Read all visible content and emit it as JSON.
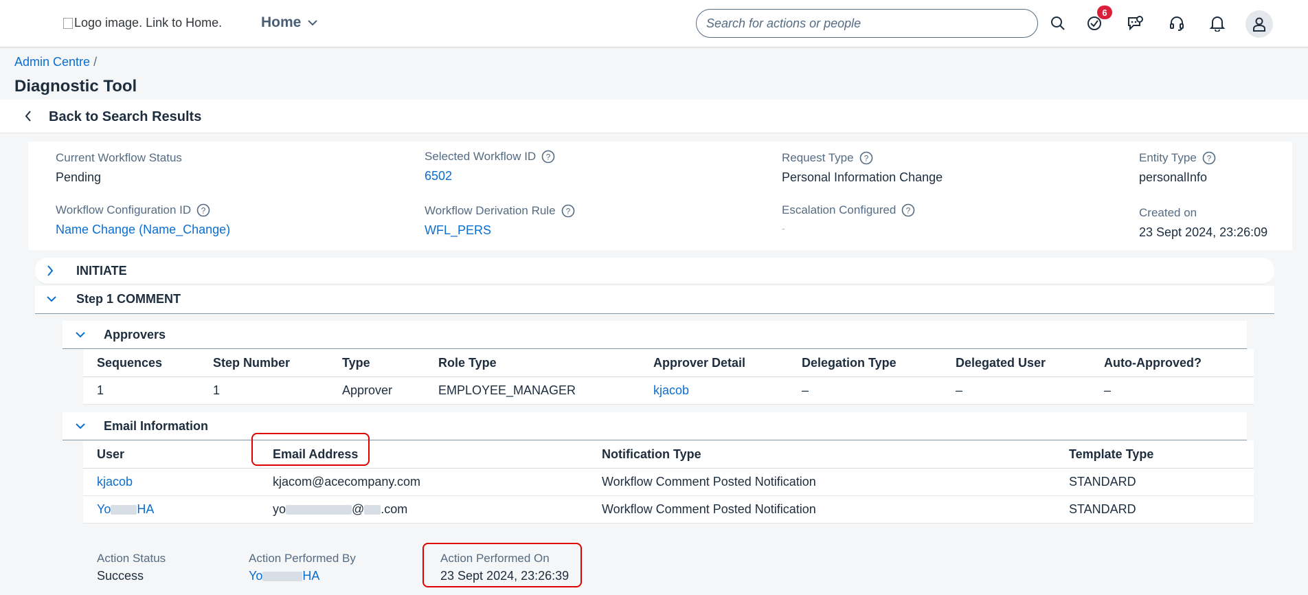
{
  "shell": {
    "logo_alt": "Logo image. Link to Home.",
    "home_label": "Home",
    "search_placeholder": "Search for actions or people",
    "notification_count": "6",
    "accent": "#0a6ed1",
    "badge_color": "#d9203a",
    "icons": [
      "search-icon",
      "task-check-icon",
      "chat-bot-icon",
      "headset-icon",
      "bell-icon",
      "user-avatar-icon"
    ]
  },
  "breadcrumb": {
    "item": "Admin Centre",
    "separator": "/"
  },
  "page_title": "Diagnostic Tool",
  "back_label": "Back to Search Results",
  "header": {
    "current_status_label": "Current Workflow Status",
    "current_status_value": "Pending",
    "workflow_id_label": "Selected Workflow ID",
    "workflow_id_value": "6502",
    "request_type_label": "Request Type",
    "request_type_value": "Personal Information Change",
    "entity_type_label": "Entity Type",
    "entity_type_value": "personalInfo",
    "config_id_label": "Workflow Configuration ID",
    "config_id_value": "Name Change (Name_Change)",
    "derivation_rule_label": "Workflow Derivation Rule",
    "derivation_rule_value": "WFL_PERS",
    "escalation_label": "Escalation Configured",
    "escalation_value": "-",
    "created_on_label": "Created on",
    "created_on_value": "23 Sept 2024, 23:26:09"
  },
  "sections": {
    "initiate": "INITIATE",
    "step1": "Step 1 COMMENT"
  },
  "approvers": {
    "title": "Approvers",
    "columns": [
      "Sequences",
      "Step Number",
      "Type",
      "Role Type",
      "Approver Detail",
      "Delegation Type",
      "Delegated User",
      "Auto-Approved?"
    ],
    "rows": [
      [
        "1",
        "1",
        "Approver",
        "EMPLOYEE_MANAGER",
        "kjacob",
        "–",
        "–",
        "–"
      ]
    ]
  },
  "email": {
    "title": "Email Information",
    "columns": [
      "User",
      "Email Address",
      "Notification Type",
      "Template Type"
    ],
    "rows": [
      [
        "kjacob",
        "kjacom@acecompany.com",
        "Workflow Comment Posted Notification",
        "STANDARD"
      ],
      [
        "Yo",
        "yo",
        "Workflow Comment Posted Notification",
        "STANDARD"
      ]
    ],
    "row2_user_suffix": "HA",
    "row2_email_mid": "@",
    "row2_email_suffix": ".com"
  },
  "action": {
    "status_label": "Action Status",
    "status_value": "Success",
    "performed_by_label": "Action Performed By",
    "performed_by_prefix": "Yo",
    "performed_by_suffix": "HA",
    "performed_on_label": "Action Performed On",
    "performed_on_value": "23 Sept 2024, 23:26:39"
  }
}
